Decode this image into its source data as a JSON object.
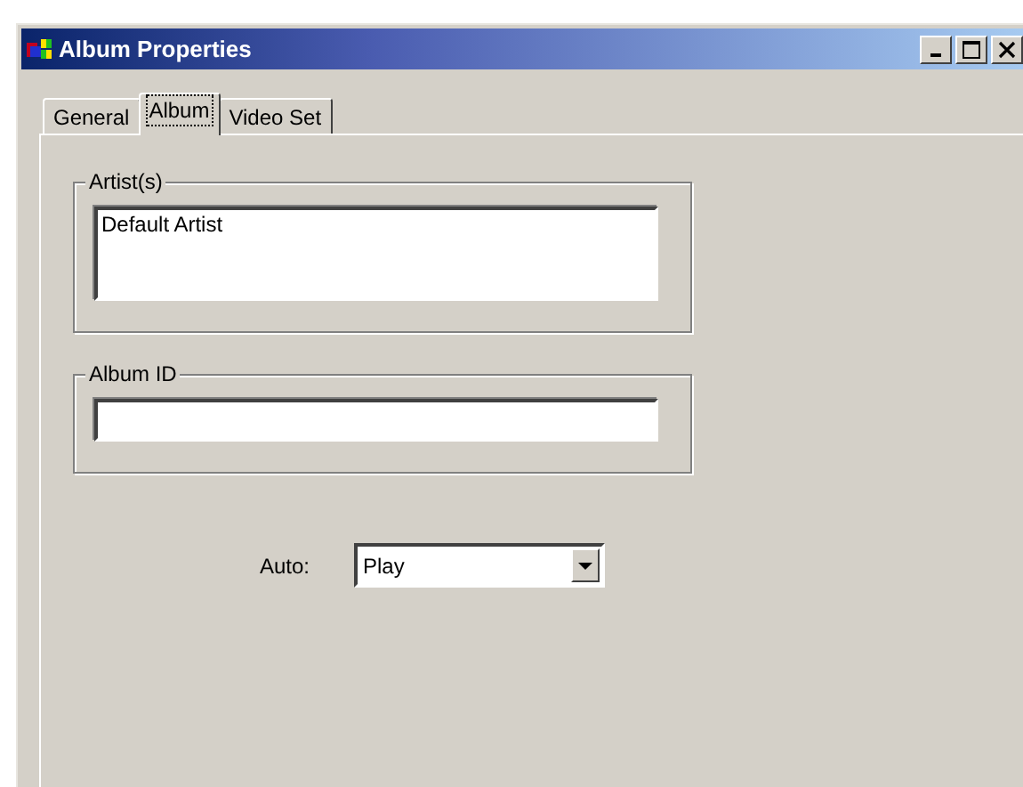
{
  "window": {
    "title": "Album Properties"
  },
  "tabs": [
    {
      "label": "General",
      "selected": false
    },
    {
      "label": "Album",
      "selected": true
    },
    {
      "label": "Video Set",
      "selected": false
    }
  ],
  "groups": [
    {
      "label": "Artist(s)",
      "kind": "multiline",
      "value": "Default Artist"
    },
    {
      "label": "Album ID",
      "kind": "single"
    }
  ],
  "auto": {
    "label": "Auto:",
    "value": "Play"
  }
}
